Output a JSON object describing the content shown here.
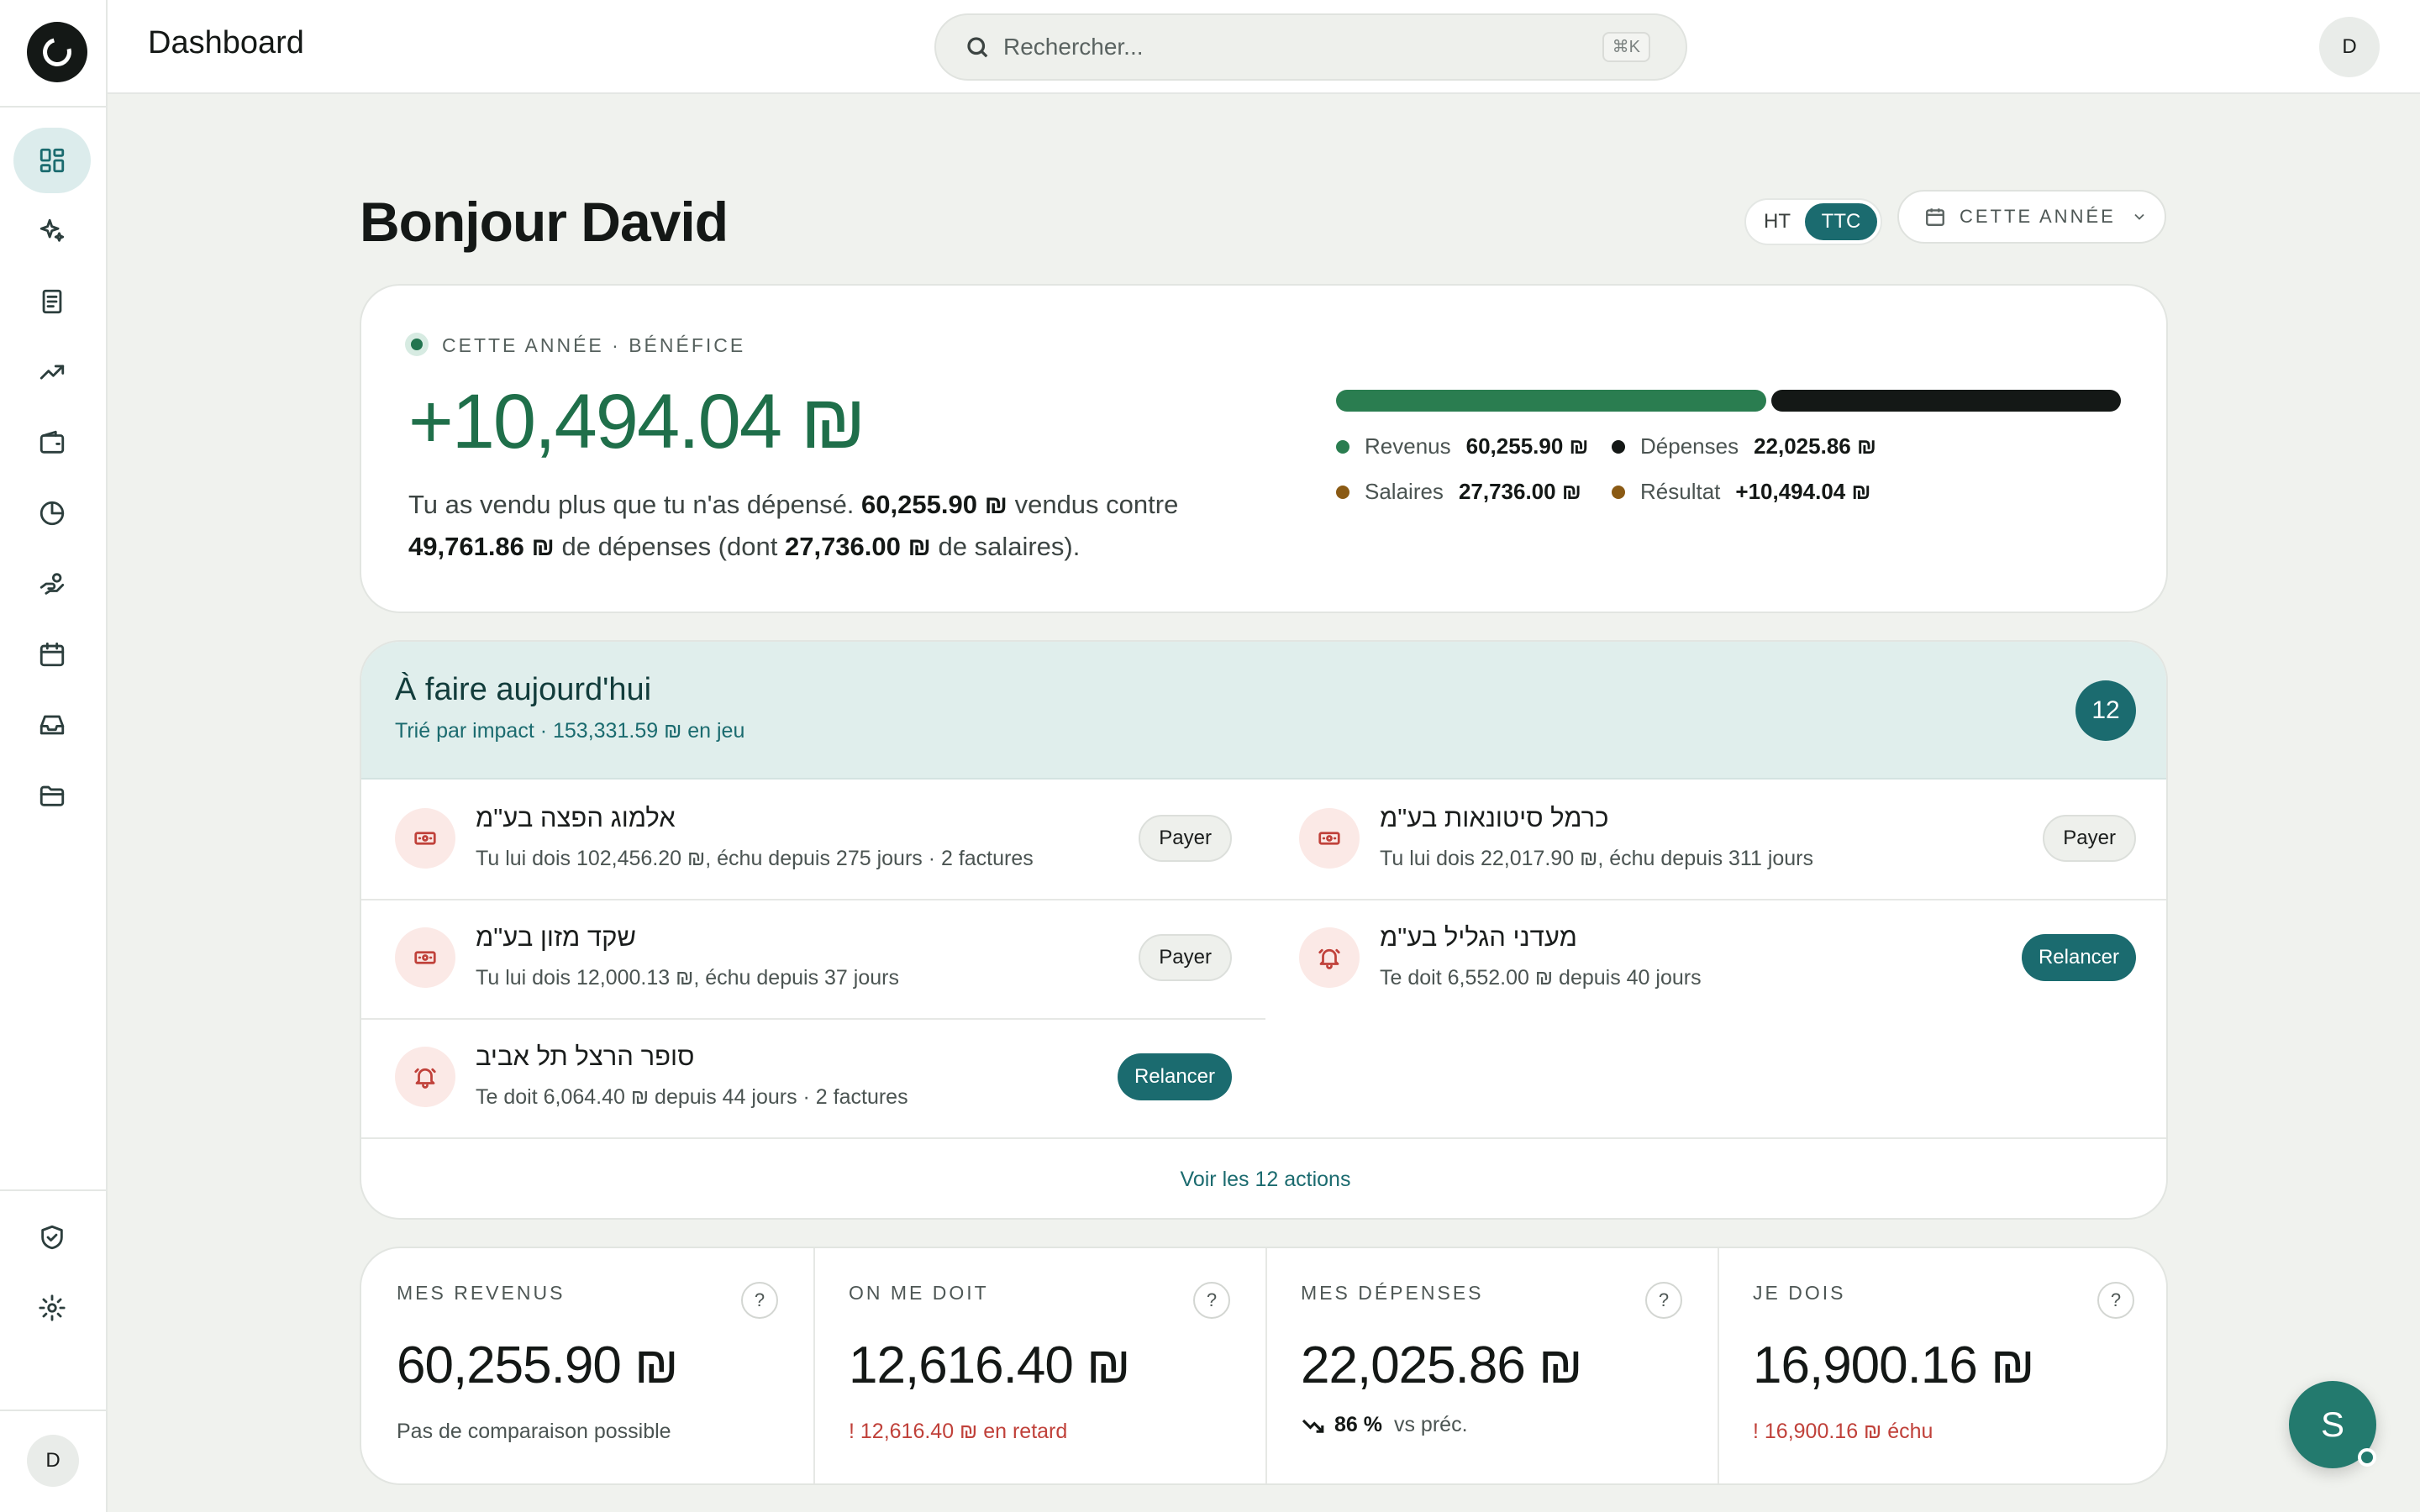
{
  "topbar": {
    "title": "Dashboard",
    "search_placeholder": "Rechercher...",
    "search_shortcut": "⌘K",
    "avatar_initial": "D"
  },
  "sidebar": {
    "items": [
      {
        "icon": "dashboard-grid-icon",
        "active": true
      },
      {
        "icon": "sparkles-icon",
        "active": false
      },
      {
        "icon": "document-icon",
        "active": false
      },
      {
        "icon": "trending-up-icon",
        "active": false
      },
      {
        "icon": "wallet-icon",
        "active": false
      },
      {
        "icon": "pie-chart-icon",
        "active": false
      },
      {
        "icon": "hand-coins-icon",
        "active": false
      },
      {
        "icon": "calendar-icon",
        "active": false
      },
      {
        "icon": "inbox-icon",
        "active": false
      },
      {
        "icon": "folder-icon",
        "active": false
      }
    ],
    "bottom_items": [
      {
        "icon": "shield-check-icon"
      },
      {
        "icon": "settings-gear-icon"
      }
    ],
    "avatar_initial": "D"
  },
  "header": {
    "greeting": "Bonjour David",
    "toggle": {
      "off": "HT",
      "on": "TTC",
      "selected": "TTC"
    },
    "period_label": "CETTE ANNÉE"
  },
  "profit": {
    "label": "CETTE ANNÉE · BÉNÉFICE",
    "amount": "+10,494.04 ₪",
    "sentence": {
      "p1": "Tu as vendu plus que tu n'as dépensé. ",
      "sold": "60,255.90 ₪",
      "p2": " vendus contre ",
      "spent": "49,761.86 ₪",
      "p3": " de dépenses (dont ",
      "salaries": "27,736.00 ₪",
      "p4": " de salaires)."
    },
    "bar_split": {
      "revenus_fraction": 0.548
    },
    "legend": [
      {
        "label": "Revenus",
        "value": "60,255.90 ₪",
        "color": "#2a7d50"
      },
      {
        "label": "Dépenses",
        "value": "22,025.86 ₪",
        "color": "#141816"
      },
      {
        "label": "Salaires",
        "value": "27,736.00 ₪",
        "color": "#8a5a14"
      },
      {
        "label": "Résultat",
        "value": "+10,494.04 ₪",
        "color": "#8a5a14"
      }
    ]
  },
  "todo": {
    "title": "À faire aujourd'hui",
    "subtitle": "Trié par impact · 153,331.59 ₪ en jeu",
    "count": "12",
    "tasks": [
      {
        "name": "אלמוג הפצה בע\"מ",
        "desc": "Tu lui dois 102,456.20 ₪, échu depuis 275 jours · 2 factures",
        "action": "Payer",
        "icon": "banknote-icon"
      },
      {
        "name": "כרמל סיטונאות בע\"מ",
        "desc": "Tu lui dois 22,017.90 ₪, échu depuis 311 jours",
        "action": "Payer",
        "icon": "banknote-icon"
      },
      {
        "name": "שקד מזון בע\"מ",
        "desc": "Tu lui dois 12,000.13 ₪, échu depuis 37 jours",
        "action": "Payer",
        "icon": "banknote-icon"
      },
      {
        "name": "מעדני הגליל בע\"מ",
        "desc": "Te doit 6,552.00 ₪ depuis 40 jours",
        "action": "Relancer",
        "icon": "bell-icon"
      },
      {
        "name": "סופר הרצל תל אביב",
        "desc": "Te doit 6,064.40 ₪ depuis 44 jours · 2 factures",
        "action": "Relancer",
        "icon": "bell-icon"
      }
    ],
    "footer_link": "Voir les 12 actions"
  },
  "stats": [
    {
      "label": "MES REVENUS",
      "help": "?",
      "value": "60,255.90 ₪",
      "note": "Pas de comparaison possible"
    },
    {
      "label": "ON ME DOIT",
      "help": "?",
      "value": "12,616.40 ₪",
      "note": "! 12,616.40 ₪ en retard"
    },
    {
      "label": "MES DÉPENSES",
      "help": "?",
      "value": "22,025.86 ₪",
      "note_pct": "86 %",
      "note_rest": "vs préc."
    },
    {
      "label": "JE DOIS",
      "help": "?",
      "value": "16,900.16 ₪",
      "note": "! 16,900.16 ₪ échu"
    }
  ],
  "fab": {
    "initial": "S"
  },
  "colors": {
    "accent": "#1b6b6f",
    "profit": "#1f6f4a",
    "danger": "#c0413a",
    "background": "#f0f2ee"
  }
}
